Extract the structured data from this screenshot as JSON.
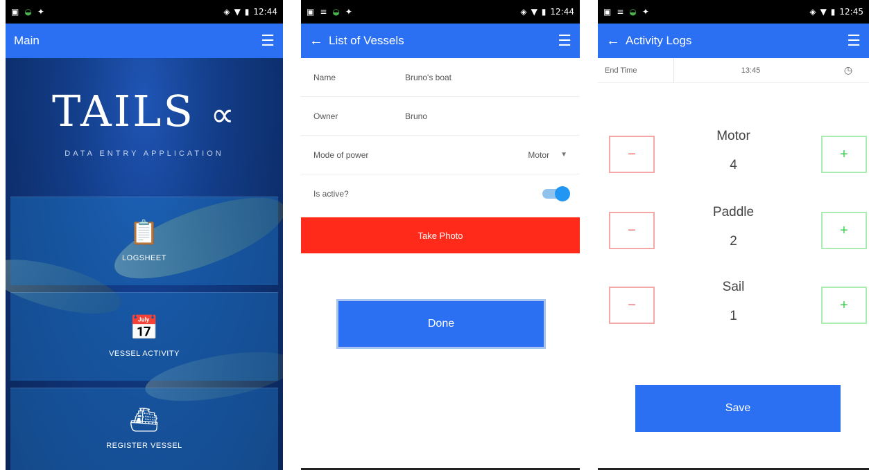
{
  "status": {
    "time": "12:44",
    "time3": "12:45",
    "icons": [
      "image-icon",
      "android-icon",
      "usb-icon",
      "wifi-icon",
      "signal-icon",
      "battery-icon"
    ]
  },
  "screen1": {
    "title": "Main",
    "logo": "TAILS",
    "subtitle": "DATA ENTRY APPLICATION",
    "tiles": [
      {
        "label": "LOGSHEET",
        "icon": "clipboard-icon"
      },
      {
        "label": "VESSEL ACTIVITY",
        "icon": "calendar-icon"
      },
      {
        "label": "REGISTER VESSEL",
        "icon": "boat-icon"
      }
    ]
  },
  "screen2": {
    "title": "List of Vessels",
    "name_label": "Name",
    "name_value": "Bruno's boat",
    "owner_label": "Owner",
    "owner_value": "Bruno",
    "power_label": "Mode of power",
    "power_value": "Motor",
    "active_label": "Is active?",
    "active": true,
    "photo_button": "Take Photo",
    "done_button": "Done"
  },
  "screen3": {
    "title": "Activity Logs",
    "end_label": "End Time",
    "end_value": "13:45",
    "counters": [
      {
        "name": "Motor",
        "value": "4"
      },
      {
        "name": "Paddle",
        "value": "2"
      },
      {
        "name": "Sail",
        "value": "1"
      }
    ],
    "minus": "−",
    "plus": "+",
    "save_button": "Save"
  },
  "colors": {
    "primary": "#2b6ff2",
    "danger": "#ff2a1a",
    "toggle": "#2196f3",
    "minus": "#f06b6b",
    "plus": "#3ccc52"
  }
}
